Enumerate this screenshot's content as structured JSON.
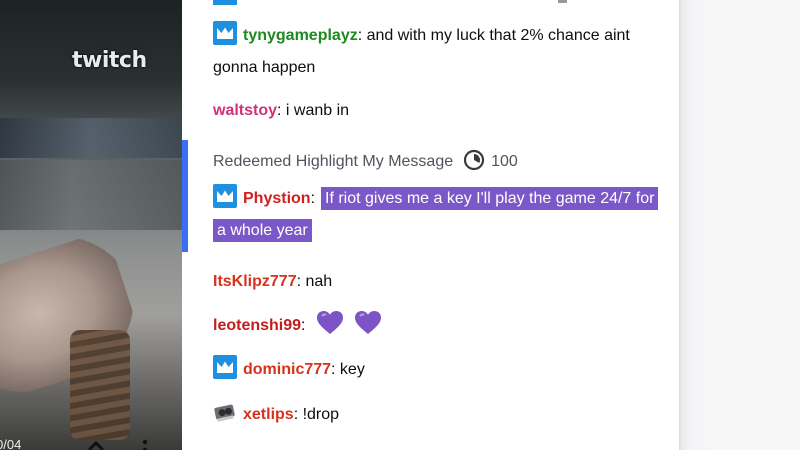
{
  "video": {
    "watermark": "twitch",
    "controls_text": "0/04"
  },
  "chat": {
    "messages": [
      {
        "username": "tynygameplayz",
        "username_color": "#1d8a1d",
        "badge": "crown-badge",
        "text": ": and with my luck that 2% chance aint gonna happen"
      },
      {
        "username": "waltstoy",
        "username_color": "#d1307d",
        "text": ": i wanb in"
      },
      {
        "redeem_label": "Redeemed Highlight My Message",
        "redeem_cost": "100"
      },
      {
        "username": "Phystion",
        "username_color": "#d11f1f",
        "badge": "crown-badge",
        "separator": ":",
        "highlighted_text": "If riot gives me a key I'll play the game 24/7 for a whole year",
        "highlight_color": "#7b58c8"
      },
      {
        "username": "ItsKlipz777",
        "username_color": "#d8321c",
        "text": ": nah"
      },
      {
        "username": "leotenshi99",
        "username_color": "#c41d1d",
        "text": ":",
        "emotes": [
          "purple-heart-emote",
          "purple-heart-emote"
        ]
      },
      {
        "username": "dominic777",
        "username_color": "#d8321c",
        "badge": "crown-badge",
        "text": ": key"
      },
      {
        "username": "xetlips",
        "username_color": "#d8321c",
        "badge": "gpu-badge",
        "text": ": !drop"
      }
    ]
  },
  "colors": {
    "highlight_bar": "#3b6ef5",
    "badge_blue": "#1f8fe0"
  }
}
